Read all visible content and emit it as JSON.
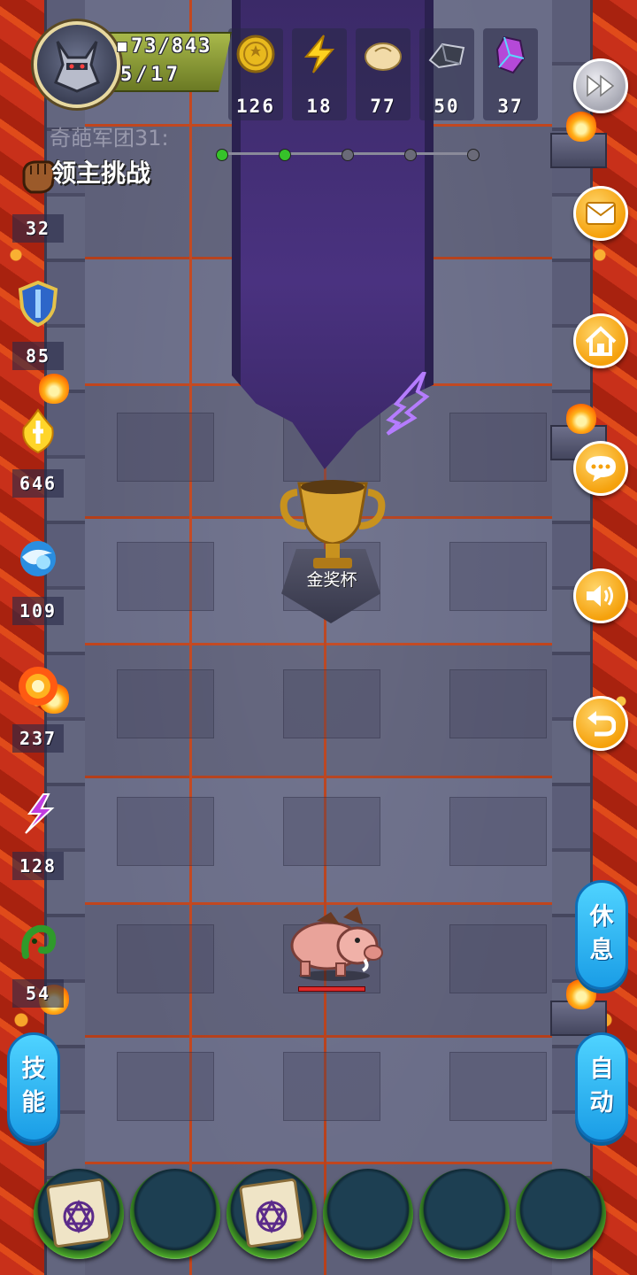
{
  "player": {
    "hp": "73/843",
    "level": "5/17"
  },
  "resources": [
    {
      "icon": "gold-coin-icon",
      "value": "126"
    },
    {
      "icon": "lightning-icon",
      "value": "18"
    },
    {
      "icon": "bun-icon",
      "value": "77"
    },
    {
      "icon": "iron-ore-icon",
      "value": "50"
    },
    {
      "icon": "crystal-icon",
      "value": "37"
    }
  ],
  "stage": {
    "subtitle": "奇葩军团31:",
    "title": "领主挑战",
    "progress_total": 5,
    "progress_done": 2
  },
  "stats": [
    {
      "icon": "fist-icon",
      "value": "32"
    },
    {
      "icon": "shield-icon",
      "value": "85"
    },
    {
      "icon": "holy-flame-icon",
      "value": "646"
    },
    {
      "icon": "water-orb-icon",
      "value": "109"
    },
    {
      "icon": "fire-orb-icon",
      "value": "237"
    },
    {
      "icon": "purple-lightning-icon",
      "value": "128"
    },
    {
      "icon": "green-tentacle-icon",
      "value": "54"
    }
  ],
  "right_buttons": [
    {
      "name": "fast-forward-button",
      "icon": "fast-forward-icon"
    },
    {
      "name": "mail-button",
      "icon": "mail-icon"
    },
    {
      "name": "home-button",
      "icon": "home-icon"
    },
    {
      "name": "chat-button",
      "icon": "chat-icon"
    },
    {
      "name": "sound-button",
      "icon": "speaker-icon"
    },
    {
      "name": "return-button",
      "icon": "return-arrow-icon"
    }
  ],
  "pills": {
    "rest": "休\n息",
    "skill": "技\n能",
    "auto": "自\n动"
  },
  "trophy": {
    "label": "金奖杯"
  },
  "enemy": {
    "name": "boar",
    "health_fraction": 1.0
  },
  "skill_slots": [
    {
      "item": "magic-scroll"
    },
    {
      "item": ""
    },
    {
      "item": "magic-scroll"
    },
    {
      "item": ""
    },
    {
      "item": ""
    },
    {
      "item": ""
    }
  ],
  "colors": {
    "accent_orange": "#f5a10c",
    "pill_blue": "#1a9de6",
    "banner_purple": "#3b2a68",
    "lava_red": "#c8301a",
    "progress_green": "#36c22a"
  }
}
